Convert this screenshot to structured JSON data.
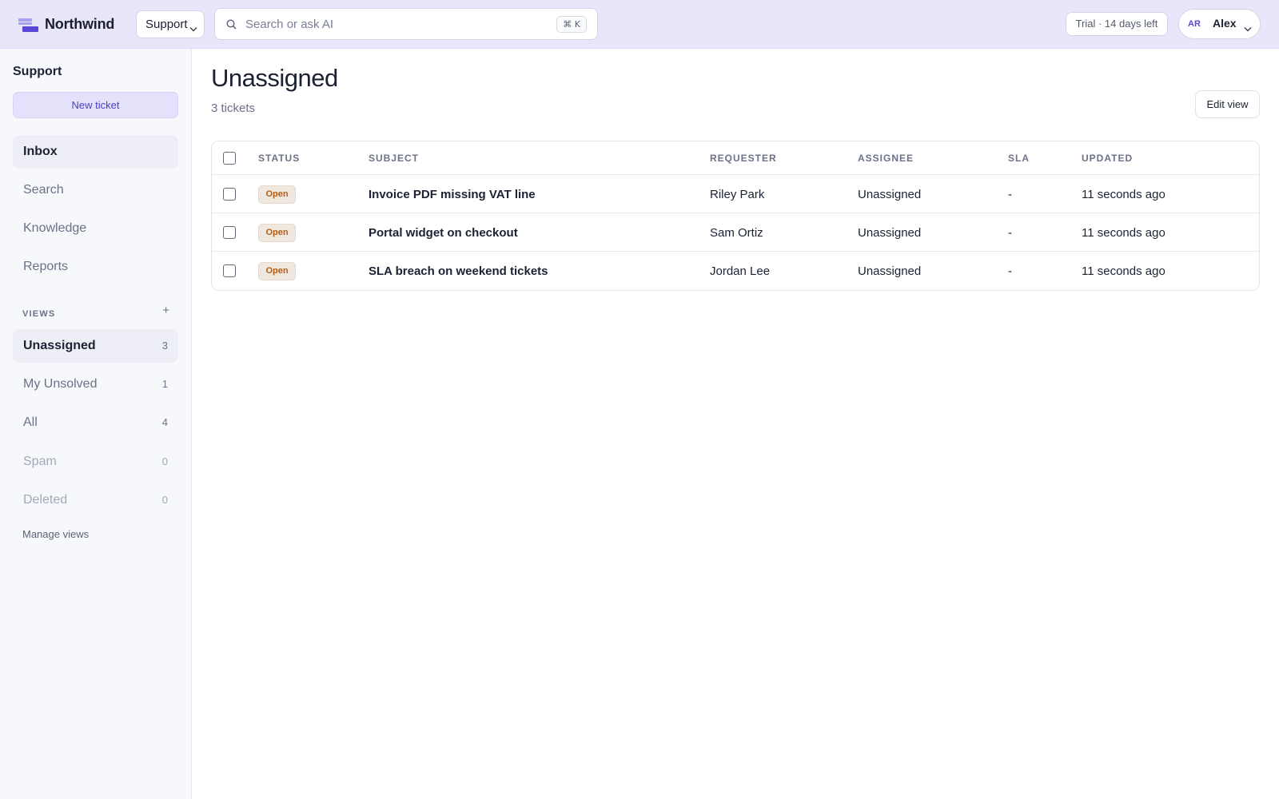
{
  "app": {
    "name": "Northwind",
    "workspace": "Support",
    "search_placeholder": "Search or ask AI",
    "search_shortcut": "⌘ K",
    "trial": "Trial · 14 days left",
    "user": {
      "initials": "AR",
      "name": "Alex"
    }
  },
  "sidebar": {
    "title": "Support",
    "new_ticket": "New ticket",
    "nav": [
      {
        "label": "Inbox"
      },
      {
        "label": "Search"
      },
      {
        "label": "Knowledge"
      },
      {
        "label": "Reports"
      }
    ],
    "views_label": "VIEWS",
    "views_add": "+",
    "views": [
      {
        "label": "Unassigned",
        "count": "3"
      },
      {
        "label": "My Unsolved",
        "count": "1"
      },
      {
        "label": "All",
        "count": "4"
      },
      {
        "label": "Spam",
        "count": "0"
      },
      {
        "label": "Deleted",
        "count": "0"
      }
    ],
    "manage_views": "Manage views"
  },
  "main": {
    "title": "Unassigned",
    "subtitle": "3 tickets",
    "edit_view": "Edit view",
    "columns": [
      "STATUS",
      "SUBJECT",
      "REQUESTER",
      "ASSIGNEE",
      "SLA",
      "UPDATED"
    ],
    "rows": [
      {
        "status": "Open",
        "subject": "Invoice PDF missing VAT line",
        "requester": "Riley Park",
        "assignee": "Unassigned",
        "sla": "-",
        "updated": "11 seconds ago"
      },
      {
        "status": "Open",
        "subject": "Portal widget on checkout",
        "requester": "Sam Ortiz",
        "assignee": "Unassigned",
        "sla": "-",
        "updated": "11 seconds ago"
      },
      {
        "status": "Open",
        "subject": "SLA breach on weekend tickets",
        "requester": "Jordan Lee",
        "assignee": "Unassigned",
        "sla": "-",
        "updated": "11 seconds ago"
      }
    ]
  },
  "colors": {
    "topbar": "#e9e6fb",
    "accent": "#5b47d6",
    "status_open_bg": "#efe8df",
    "status_open_text": "#b45d17"
  },
  "icons": {
    "logo": "northwind-logo-icon",
    "search": "search-icon",
    "chevron": "chevron-down-icon",
    "plus": "plus-icon"
  }
}
